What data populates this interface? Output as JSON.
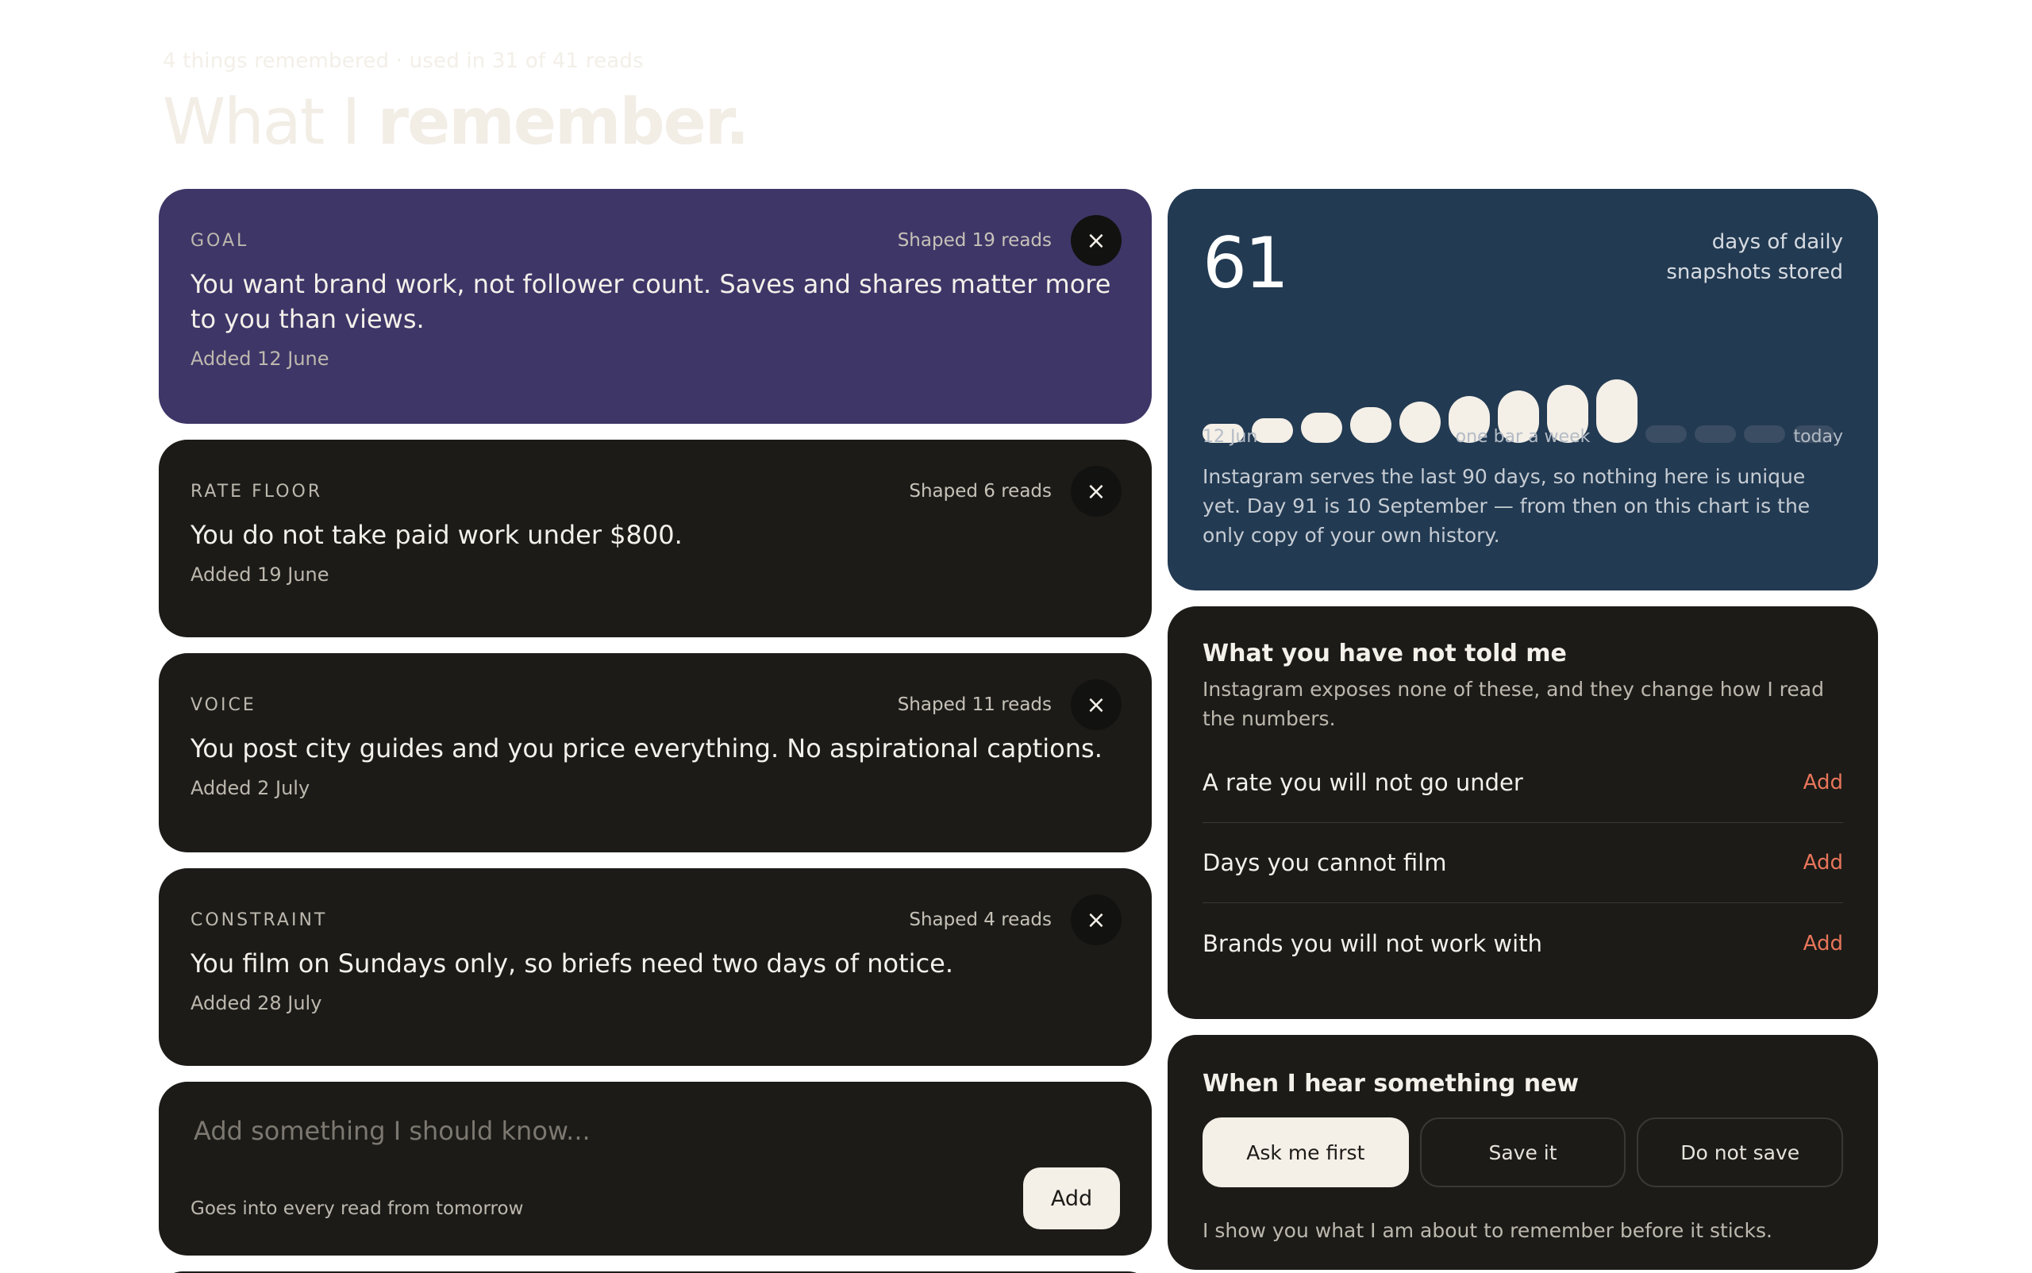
{
  "header": {
    "subline": "4 things remembered · used in 31 of 41 reads",
    "title_light": "What I ",
    "title_bold": "remember."
  },
  "memories": [
    {
      "tag": "GOAL",
      "shaped": "Shaped 19 reads",
      "text": "You want brand work, not follower count. Saves and shares matter more to you than views.",
      "added": "Added 12 June",
      "color": "#3e3667"
    },
    {
      "tag": "RATE FLOOR",
      "shaped": "Shaped 6 reads",
      "text": "You do not take paid work under $800.",
      "added": "Added 19 June"
    },
    {
      "tag": "VOICE",
      "shaped": "Shaped 11 reads",
      "text": "You post city guides and you price everything. No aspirational captions.",
      "added": "Added 2 July"
    },
    {
      "tag": "CONSTRAINT",
      "shaped": "Shaped 4 reads",
      "text": "You film on Sundays only, so briefs need two days of notice.",
      "added": "Added 28 July"
    }
  ],
  "close_glyph": "×",
  "add_memory": {
    "placeholder": "Add something I should know...",
    "hint": "Goes into every read from tomorrow",
    "button": "Add"
  },
  "snapshots": {
    "number": "61",
    "caption_line1": "days of daily",
    "caption_line2": "snapshots stored",
    "scale_start": "12 Jun",
    "scale_mid": "one bar a week",
    "scale_end": "today",
    "note": "Instagram serves the last 90 days, so nothing here is unique yet. Day 91 is 10 September — from then on this chart is the only copy of your own history.",
    "bar_color": "#f4efe7",
    "empty_color": "#3a4d62"
  },
  "chart_data": {
    "type": "bar",
    "categories": [
      "12 Jun",
      "today"
    ],
    "values": [
      1,
      2,
      3,
      4,
      5,
      6,
      7,
      8,
      9,
      0,
      0,
      0,
      0
    ],
    "title": "",
    "xlabel": "one bar a week",
    "ylabel": ""
  },
  "untold": {
    "title": "What you have not told me",
    "subtitle": "Instagram exposes none of these, and they change how I read the numbers.",
    "items": [
      {
        "label": "A rate you will not go under",
        "action": "Add"
      },
      {
        "label": "Days you cannot film",
        "action": "Add"
      },
      {
        "label": "Brands you will not work with",
        "action": "Add"
      }
    ],
    "accent": "#e8755a"
  },
  "hear": {
    "title": "When I hear something new",
    "options": [
      "Ask me first",
      "Save it",
      "Do not save"
    ],
    "selected": "Ask me first",
    "note": "I show you what I am about to remember before it sticks."
  }
}
